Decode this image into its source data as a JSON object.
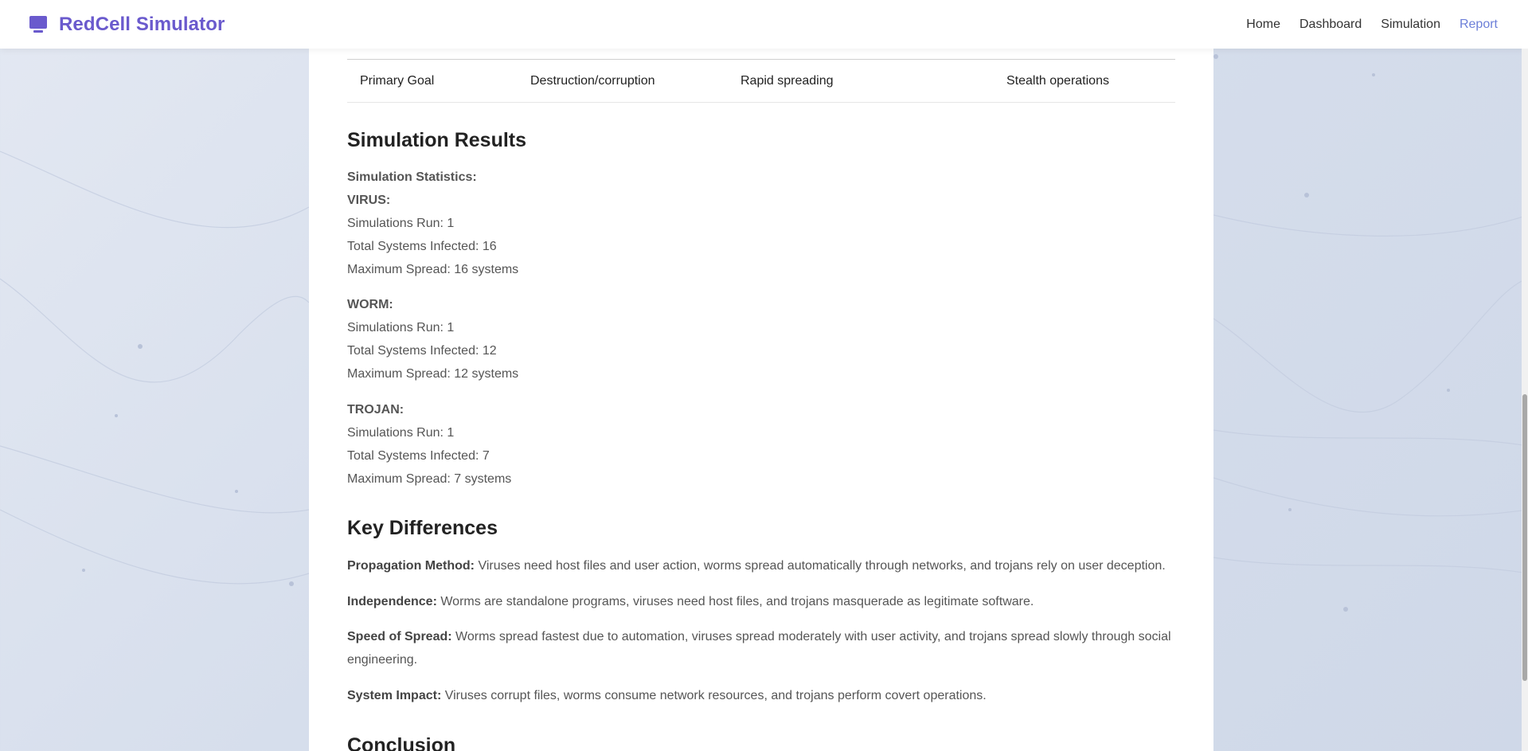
{
  "nav": {
    "brand": "RedCell Simulator",
    "links": [
      "Home",
      "Dashboard",
      "Simulation",
      "Report"
    ],
    "active": "Report"
  },
  "table": {
    "row": {
      "label": "Primary Goal",
      "virus": "Destruction/corruption",
      "worm": "Rapid spreading",
      "trojan": "Stealth operations"
    }
  },
  "results": {
    "title": "Simulation Results",
    "stats_heading": "Simulation Statistics:",
    "groups": [
      {
        "name": "VIRUS:",
        "runs": "Simulations Run: 1",
        "infected": "Total Systems Infected: 16",
        "spread": "Maximum Spread: 16 systems"
      },
      {
        "name": "WORM:",
        "runs": "Simulations Run: 1",
        "infected": "Total Systems Infected: 12",
        "spread": "Maximum Spread: 12 systems"
      },
      {
        "name": "TROJAN:",
        "runs": "Simulations Run: 1",
        "infected": "Total Systems Infected: 7",
        "spread": "Maximum Spread: 7 systems"
      }
    ]
  },
  "differences": {
    "title": "Key Differences",
    "items": [
      {
        "label": "Propagation Method:",
        "text": "Viruses need host files and user action, worms spread automatically through networks, and trojans rely on user deception."
      },
      {
        "label": "Independence:",
        "text": "Worms are standalone programs, viruses need host files, and trojans masquerade as legitimate software."
      },
      {
        "label": "Speed of Spread:",
        "text": "Worms spread fastest due to automation, viruses spread moderately with user activity, and trojans spread slowly through social engineering."
      },
      {
        "label": "System Impact:",
        "text": "Viruses corrupt files, worms consume network resources, and trojans perform covert operations."
      }
    ]
  },
  "conclusion": {
    "title": "Conclusion"
  },
  "colors": {
    "brand": "#6a5acd",
    "active_link": "#6c7fd8",
    "text": "#555555"
  }
}
